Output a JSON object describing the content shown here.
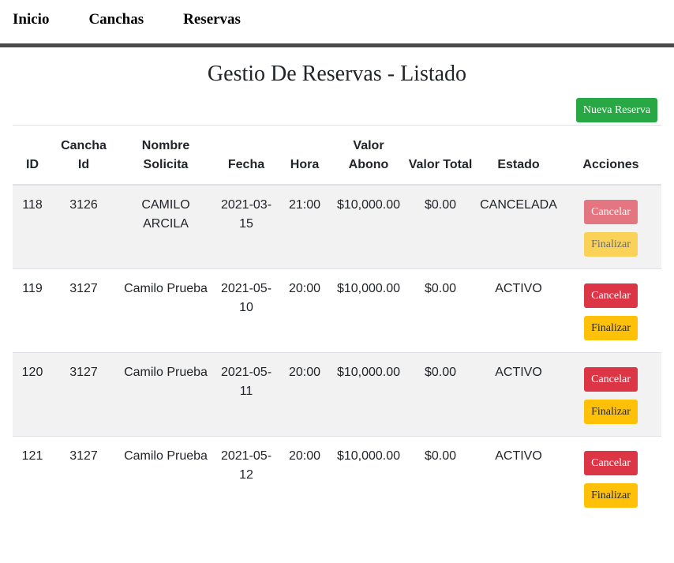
{
  "nav": {
    "items": [
      "Inicio",
      "Canchas",
      "Reservas"
    ]
  },
  "page": {
    "title": "Gestio De Reservas - Listado",
    "new_button": "Nueva Reserva"
  },
  "table": {
    "headers": [
      "ID",
      "Cancha Id",
      "Nombre Solicita",
      "Fecha",
      "Hora",
      "Valor Abono",
      "Valor Total",
      "Estado",
      "Acciones"
    ],
    "rows": [
      {
        "id": "118",
        "cancha": "3126",
        "nombre": "CAMILO ARCILA",
        "fecha": "2021-03-15",
        "hora": "21:00",
        "abono": "$10,000.00",
        "total": "$0.00",
        "estado": "CANCELADA",
        "cancel": "Cancelar",
        "finish": "Finalizar",
        "disabled": true
      },
      {
        "id": "119",
        "cancha": "3127",
        "nombre": "Camilo Prueba",
        "fecha": "2021-05-10",
        "hora": "20:00",
        "abono": "$10,000.00",
        "total": "$0.00",
        "estado": "ACTIVO",
        "cancel": "Cancelar",
        "finish": "Finalizar",
        "disabled": false
      },
      {
        "id": "120",
        "cancha": "3127",
        "nombre": "Camilo Prueba",
        "fecha": "2021-05-11",
        "hora": "20:00",
        "abono": "$10,000.00",
        "total": "$0.00",
        "estado": "ACTIVO",
        "cancel": "Cancelar",
        "finish": "Finalizar",
        "disabled": false
      },
      {
        "id": "121",
        "cancha": "3127",
        "nombre": "Camilo Prueba",
        "fecha": "2021-05-12",
        "hora": "20:00",
        "abono": "$10,000.00",
        "total": "$0.00",
        "estado": "ACTIVO",
        "cancel": "Cancelar",
        "finish": "Finalizar",
        "disabled": false
      }
    ]
  },
  "colors": {
    "success": "#28a745",
    "danger": "#dc3545",
    "warning": "#ffc107",
    "stripe": "#f2f2f2"
  }
}
